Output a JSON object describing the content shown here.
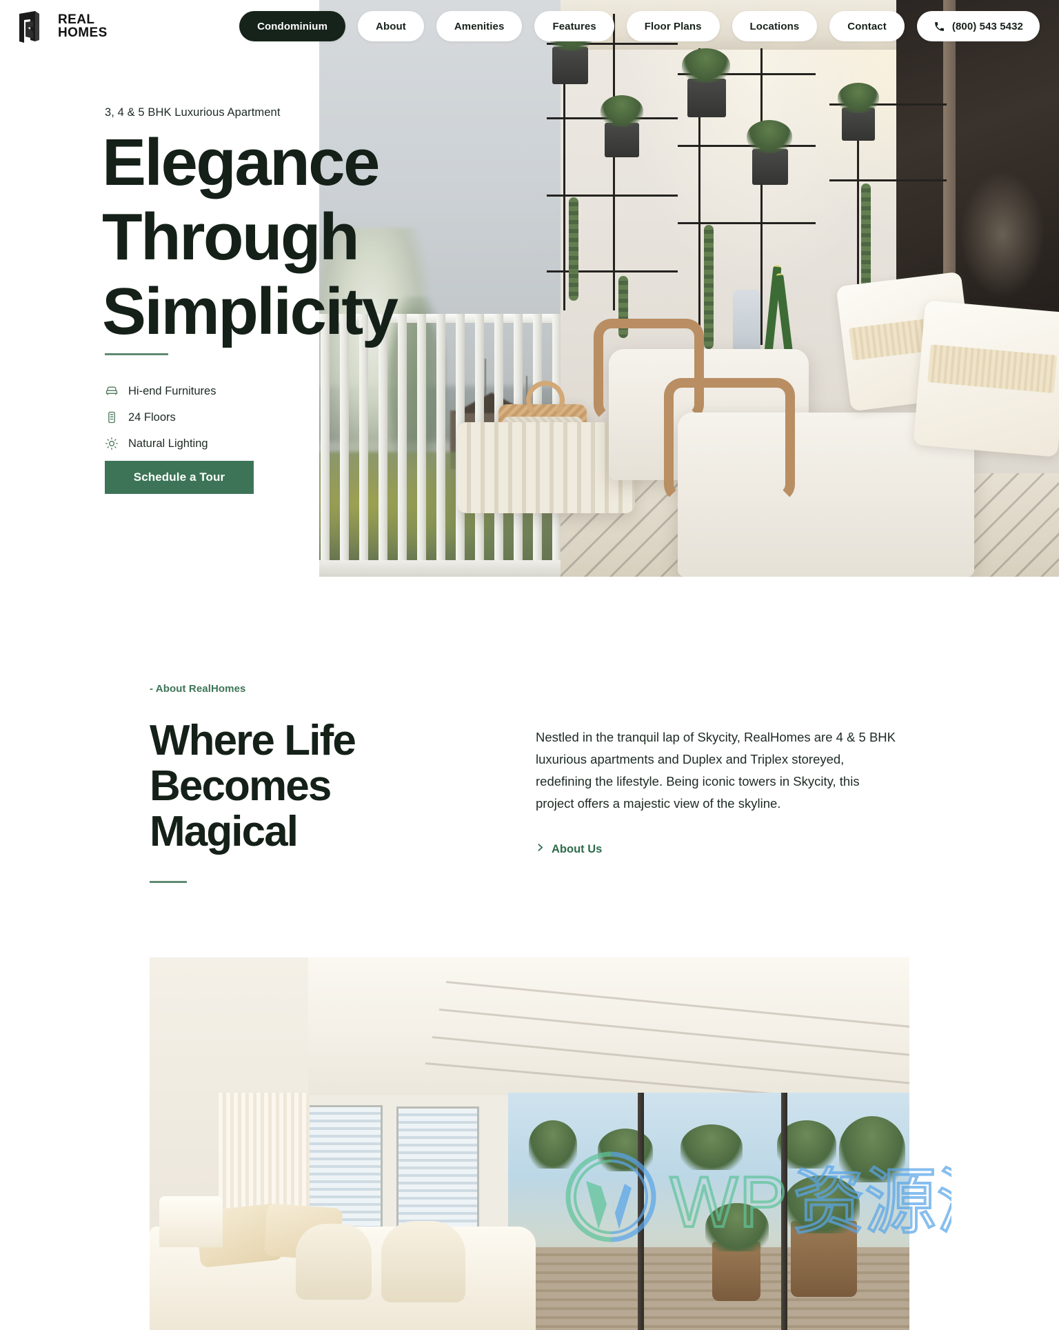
{
  "brand": {
    "logo_icon": "realhomes-door-logo-icon",
    "line1": "REAL",
    "line2": "HOMES"
  },
  "nav": {
    "items": [
      {
        "label": "Condominium",
        "active": true
      },
      {
        "label": "About",
        "active": false
      },
      {
        "label": "Amenities",
        "active": false
      },
      {
        "label": "Features",
        "active": false
      },
      {
        "label": "Floor Plans",
        "active": false
      },
      {
        "label": "Locations",
        "active": false
      },
      {
        "label": "Contact",
        "active": false
      }
    ],
    "phone": {
      "icon": "phone-icon",
      "label": "(800) 543 5432"
    }
  },
  "hero": {
    "eyebrow": "3, 4 & 5 BHK Luxurious Apartment",
    "title_line1": "Elegance",
    "title_line2": "Through",
    "title_line3": "Simplicity",
    "features": [
      {
        "icon": "armchair-icon",
        "label": "Hi-end Furnitures"
      },
      {
        "icon": "building-floors-icon",
        "label": "24 Floors"
      },
      {
        "icon": "sun-icon",
        "label": "Natural Lighting"
      }
    ],
    "cta_label": "Schedule a Tour"
  },
  "about": {
    "kicker": "- About RealHomes",
    "title_line1": "Where Life",
    "title_line2": "Becomes",
    "title_line3": "Magical",
    "paragraph": "Nestled in the tranquil lap of Skycity, RealHomes are 4 & 5 BHK luxurious apartments and Duplex and Triplex storeyed, redefining the lifestyle. Being iconic towers in Skycity, this project offers a majestic view of the skyline.",
    "link_label": "About Us",
    "link_icon": "chevron-right-icon"
  },
  "watermark": {
    "logo_icon": "wordpress-logo-icon",
    "text_latin": "WP",
    "text_cjk": "资源海",
    "color_green": "#5fc49a",
    "color_blue": "#5aa6e8"
  },
  "colors": {
    "accent_green": "#3d7457",
    "heading_dark": "#142018",
    "nav_active_bg": "#16231a",
    "rule_green": "#5f8a72",
    "page_bg": "#ffffff"
  }
}
